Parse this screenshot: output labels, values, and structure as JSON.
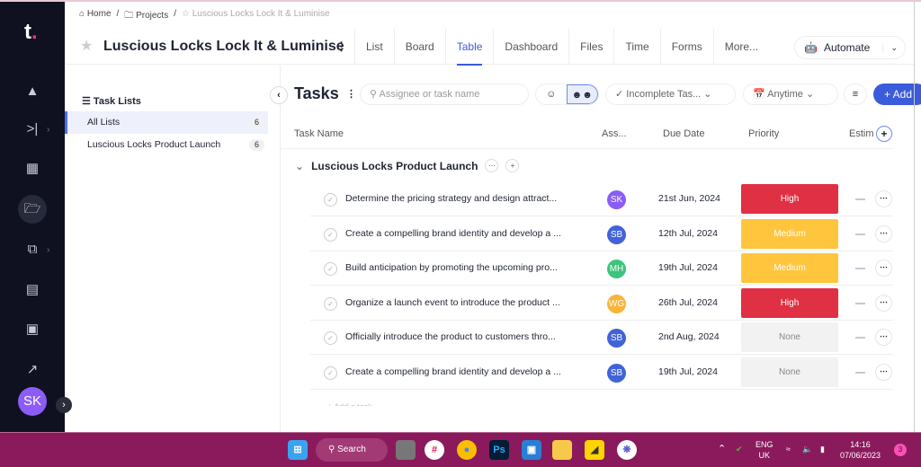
{
  "breadcrumb": [
    "Home",
    "/",
    "Projects",
    "/",
    "Luscious Locks Lock It & Luminise"
  ],
  "project": {
    "title": "Luscious Locks Lock It & Luminise"
  },
  "tabs": [
    "List",
    "Board",
    "Table",
    "Dashboard",
    "Files",
    "Time",
    "Forms",
    "More..."
  ],
  "active_tab": "Table",
  "automate_label": "Automate",
  "sidebar": {
    "logo": "t",
    "avatar": "SK",
    "icons": [
      "rocket-icon",
      "collapse-right-icon",
      "building-icon",
      "folder-icon",
      "portfolio-icon",
      "report-icon",
      "wallet-icon",
      "analytics-icon"
    ]
  },
  "task_lists": {
    "title": "Task Lists",
    "items": [
      {
        "label": "All Lists",
        "count": "6"
      },
      {
        "label": "Luscious Locks Product Launch",
        "count": "6"
      }
    ]
  },
  "toolbar": {
    "title": "Tasks",
    "search_placeholder": "Assignee or task name",
    "status_filter": "Incomplete Tas...",
    "date_filter": "Anytime",
    "add_label": "+ Add"
  },
  "columns": [
    "Task Name",
    "Ass...",
    "Due Date",
    "Priority",
    "Estim"
  ],
  "group": {
    "name": "Luscious Locks Product Launch"
  },
  "colors": {
    "accent": "#3b5bdb",
    "high": "#e03043",
    "medium": "#ffc53d",
    "none": "#f2f2f2"
  },
  "tasks": [
    {
      "name": "Determine the pricing strategy and design attract...",
      "assignee": "SK",
      "assignee_color": "#8b5cf6",
      "due": "21st Jun, 2024",
      "priority": "High"
    },
    {
      "name": "Create a compelling brand identity and develop a ...",
      "assignee": "SB",
      "assignee_color": "#4263d8",
      "due": "12th Jul, 2024",
      "priority": "Medium"
    },
    {
      "name": "Build anticipation by promoting the upcoming pro...",
      "assignee": "MH",
      "assignee_color": "#3cc47c",
      "due": "19th Jul, 2024",
      "priority": "Medium"
    },
    {
      "name": "Organize a launch event to introduce the product ...",
      "assignee": "WG",
      "assignee_color": "#f9b53a",
      "due": "26th Jul, 2024",
      "priority": "High"
    },
    {
      "name": "Officially introduce the product to customers thro...",
      "assignee": "SB",
      "assignee_color": "#4263d8",
      "due": "2nd Aug, 2024",
      "priority": "None"
    },
    {
      "name": "Create a compelling brand identity and develop a ...",
      "assignee": "SB",
      "assignee_color": "#4263d8",
      "due": "19th Jul, 2024",
      "priority": "None"
    }
  ],
  "add_task": "+ Add a task",
  "taskbar": {
    "search": "Search",
    "lang": "ENG",
    "region": "UK",
    "time": "14:16",
    "date": "07/06/2023",
    "notifications": "3"
  }
}
